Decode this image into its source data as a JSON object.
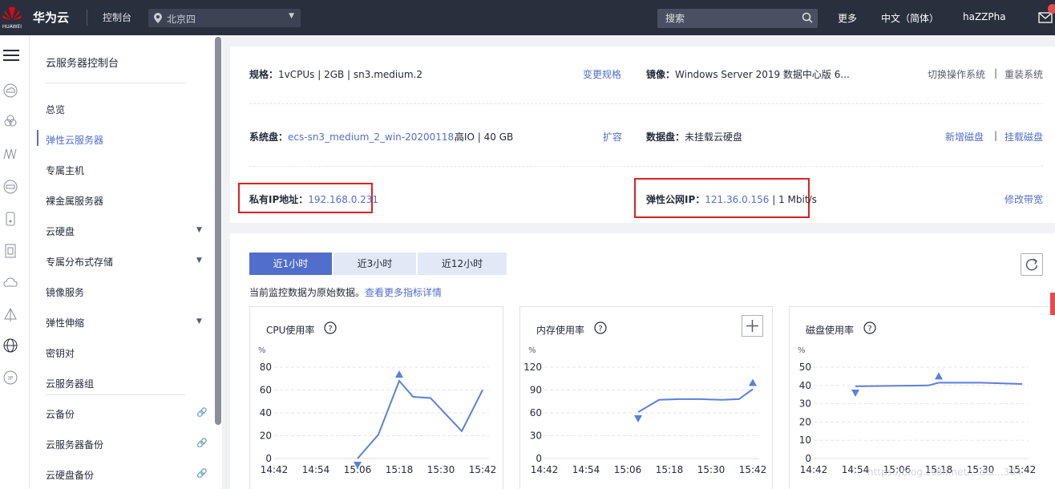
{
  "topbar": {
    "brand": "华为云",
    "logo_text": "HUAWEI",
    "console": "控制台",
    "region": "北京四",
    "search_placeholder": "搜索",
    "more": "更多",
    "language": "中文（简体）",
    "user": "haZZPha"
  },
  "rail": {
    "icons": [
      "menu-icon",
      "cloud-server-icon",
      "cloud-icon",
      "network-icon",
      "storage-icon",
      "disk-icon",
      "file-icon",
      "cloud-backup-icon",
      "scaling-icon",
      "globe-icon",
      "ip-icon"
    ]
  },
  "sidebar": {
    "title": "云服务器控制台",
    "items": [
      {
        "label": "总览"
      },
      {
        "label": "弹性云服务器"
      },
      {
        "label": "专属主机"
      },
      {
        "label": "裸金属服务器"
      },
      {
        "label": "云硬盘"
      },
      {
        "label": "专属分布式存储"
      },
      {
        "label": "镜像服务"
      },
      {
        "label": "弹性伸缩"
      },
      {
        "label": "密钥对"
      },
      {
        "label": "云服务器组"
      },
      {
        "label": "云备份"
      },
      {
        "label": "云服务器备份"
      },
      {
        "label": "云硬盘备份"
      }
    ]
  },
  "info": {
    "spec_label": "规格：",
    "spec_value": "1vCPUs | 2GB | sn3.medium.2",
    "spec_action": "变更规格",
    "image_label": "镜像：",
    "image_value": "Windows Server 2019 数据中心版 6...",
    "switch_os": "切换操作系统",
    "action_sep": "|",
    "reinstall_os": "重装系统",
    "sysdisk_label": "系统盘：",
    "sysdisk_value": "ecs-sn3_medium_2_win-20200118...",
    "sysdisk_extra": "高IO | 40 GB",
    "expand": "扩容",
    "datadisk_label": "数据盘：",
    "datadisk_value": "未挂载云硬盘",
    "add_disk": "新增磁盘",
    "attach_disk": "挂载磁盘",
    "private_ip_label": "私有IP地址：",
    "private_ip": "192.168.0.231",
    "eip_label": "弹性公网IP：",
    "eip": "121.36.0.156",
    "bandwidth": "| 1 Mbit/s",
    "modify_bandwidth": "修改带宽"
  },
  "monitor": {
    "tabs": [
      "近1小时",
      "近3小时",
      "近12小时"
    ],
    "active_tab": 0,
    "note": "当前监控数据为原始数据。",
    "note_link": "查看更多指标详情",
    "watermark": "https://blog.csdn.net/...dia...304"
  },
  "chart_data": [
    {
      "type": "line",
      "title": "CPU使用率",
      "ylabel": "%",
      "ylim": [
        0,
        80
      ],
      "yticks": [
        0,
        20,
        40,
        60,
        80
      ],
      "xticks": [
        "14:42",
        "14:54",
        "15:06",
        "15:18",
        "15:30",
        "15:42"
      ],
      "x": [
        "15:06",
        "15:12",
        "15:18",
        "15:22",
        "15:27",
        "15:36",
        "15:42"
      ],
      "values": [
        0,
        21,
        68,
        54,
        53,
        24,
        60
      ],
      "max_marker": {
        "x": "15:18",
        "y": 68
      },
      "min_marker": {
        "x": "15:06",
        "y": 0
      },
      "color": "#5b7fde"
    },
    {
      "type": "line",
      "title": "内存使用率",
      "ylabel": "%",
      "ylim": [
        0,
        120
      ],
      "yticks": [
        0,
        30,
        60,
        90,
        120
      ],
      "xticks": [
        "14:42",
        "14:54",
        "15:06",
        "15:18",
        "15:30",
        "15:42"
      ],
      "x": [
        "15:09",
        "15:15",
        "15:21",
        "15:27",
        "15:33",
        "15:38",
        "15:42"
      ],
      "values": [
        61,
        77,
        78,
        78,
        77,
        78,
        91
      ],
      "max_marker": {
        "x": "15:42",
        "y": 91
      },
      "min_marker": {
        "x": "15:09",
        "y": 61
      },
      "color": "#5b7fde"
    },
    {
      "type": "line",
      "title": "磁盘使用率",
      "ylabel": "%",
      "ylim": [
        0,
        50
      ],
      "yticks": [
        0,
        10,
        20,
        30,
        40,
        50
      ],
      "xticks": [
        "14:42",
        "14:54",
        "15:06",
        "15:18",
        "15:30",
        "15:42"
      ],
      "x": [
        "14:54",
        "15:06",
        "15:15",
        "15:18",
        "15:30",
        "15:42"
      ],
      "values": [
        39.5,
        39.8,
        40,
        41.5,
        41.5,
        40.8
      ],
      "max_marker": {
        "x": "15:18",
        "y": 41.5
      },
      "min_marker": {
        "x": "14:54",
        "y": 39.5
      },
      "color": "#5b7fde"
    }
  ]
}
